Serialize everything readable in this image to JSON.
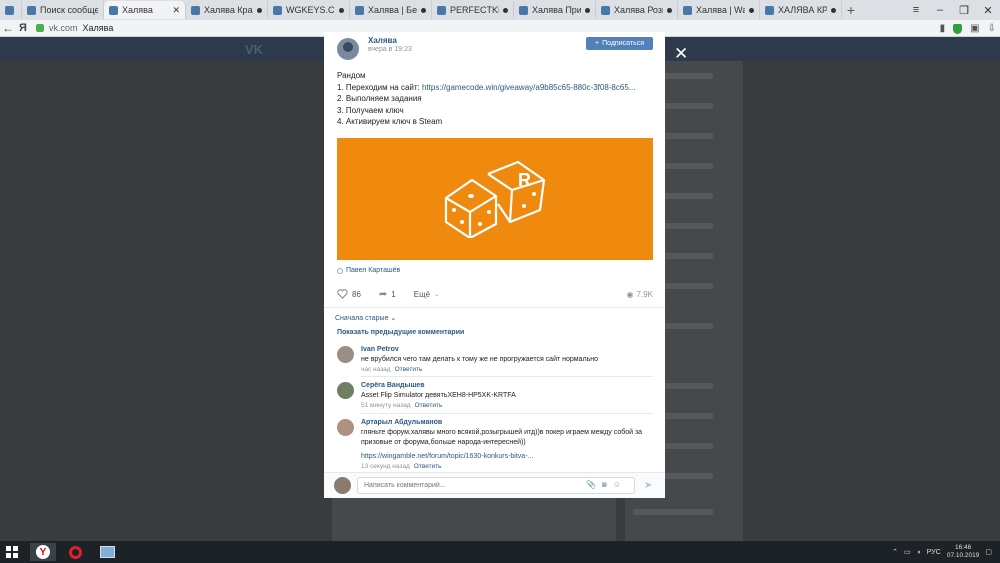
{
  "browser": {
    "tabs": [
      {
        "label": "Поиск сообществ"
      },
      {
        "label": "Халява"
      },
      {
        "label": "Халява Красн"
      },
      {
        "label": "WGKEYS.COM"
      },
      {
        "label": "Халява | Безко"
      },
      {
        "label": "PERFECTKEYS"
      },
      {
        "label": "Халява Приди"
      },
      {
        "label": "Халява Розыгр"
      },
      {
        "label": "Халява | Warfa"
      },
      {
        "label": "ХАЛЯВА КРАС"
      }
    ],
    "address_host": "vk.com",
    "address_title": "Халява"
  },
  "post": {
    "author": "Халява",
    "time": "вчера в 19:23",
    "subscribe_label": "Подписаться",
    "text_line1": "Рандом",
    "text_line2_prefix": "1. Переходим на сайт: ",
    "text_link": "https://gamecode.win/giveaway/a9b85c65-880c-3f08-8c65...",
    "text_line3": "2. Выполняем задания",
    "text_line4": "3. Получаем ключ",
    "text_line5": "4. Активируем ключ в Steam",
    "image_letter": "R",
    "signer": "Павел Карташёв",
    "likes": "86",
    "shares": "1",
    "more_label": "Ещё",
    "views": "7.9K"
  },
  "comments_section": {
    "sort_label": "Сначала старые",
    "prev_label": "Показать предыдущие комментарии",
    "comments": [
      {
        "name": "Ivan Petrov",
        "text": "не врубился чего там делать к тому же не прогружается сайт нормально",
        "time": "час назад",
        "reply": "Ответить"
      },
      {
        "name": "Серёга Вандышев",
        "text": "Asset Flip Simulator девятьXEH8-HP5XK-KRTFA",
        "time": "51 минуту назад",
        "reply": "Ответить"
      },
      {
        "name": "Артарыл Абдульманов",
        "text": "гляньте форум,халявы много всякой,розыгрышей итд))в покер играем между собой за призовые от форума,больше народа-интересней))",
        "link": "https://wingamble.net/forum/topic/1630-konkurs-bitva-...",
        "time": "13 секунд назад",
        "reply": "Ответить"
      }
    ],
    "input_placeholder": "Написать комментарий..."
  },
  "taskbar": {
    "lang": "РУС",
    "time": "16:46",
    "date": "07.10.2019"
  },
  "colors": {
    "accent": "#5181b8",
    "link": "#2a5885",
    "image_bg": "#ef8a0f"
  }
}
